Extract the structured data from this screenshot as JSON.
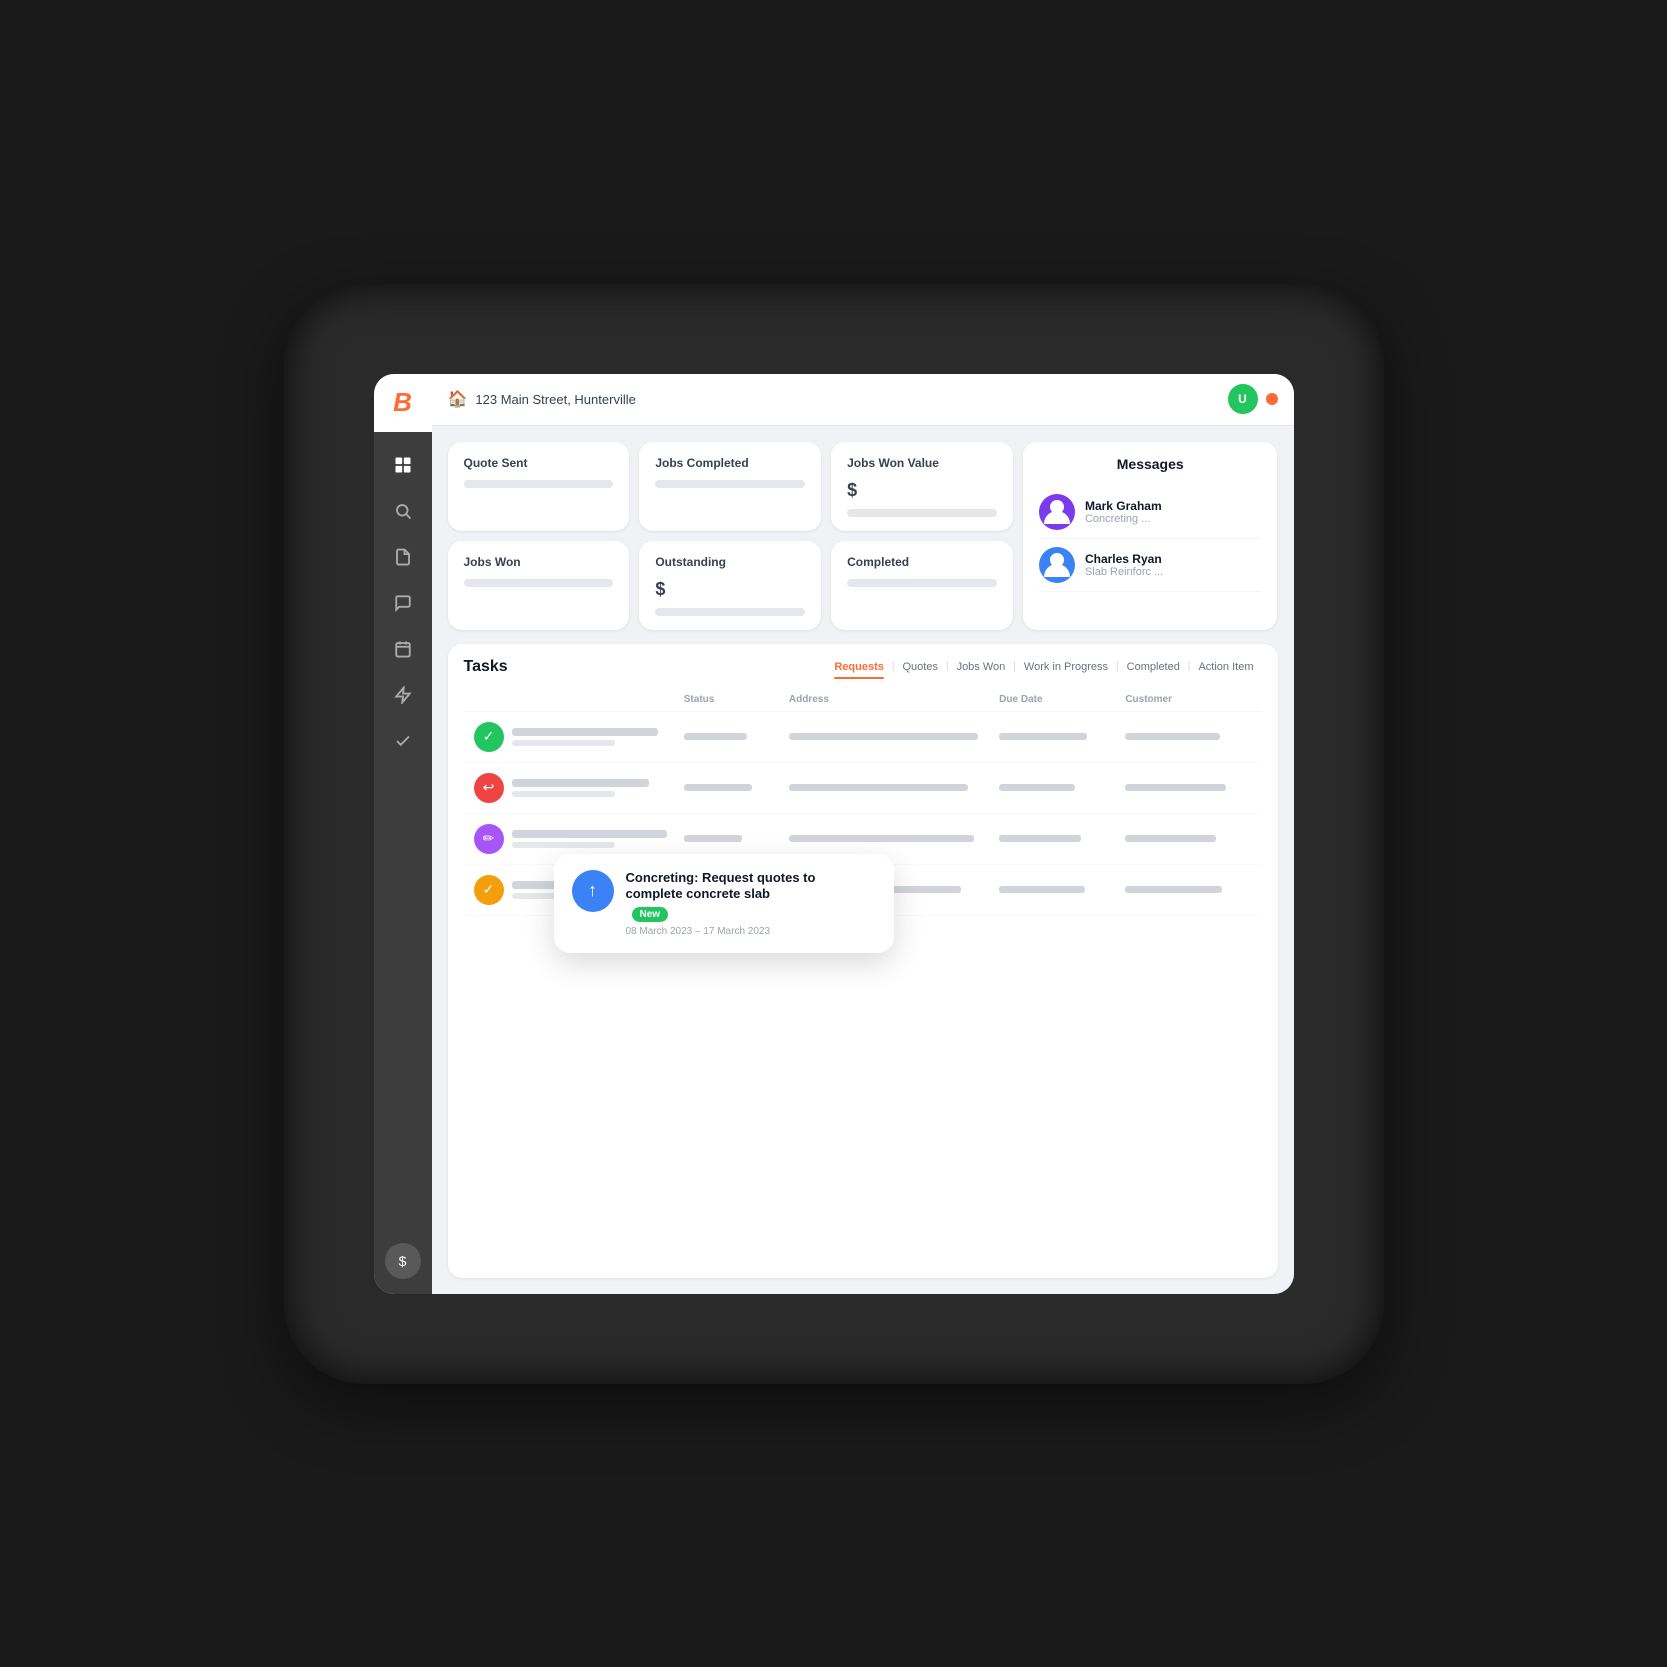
{
  "device": {
    "topbar": {
      "address": "123 Main Street, Hunterville",
      "home_icon": "🏠"
    }
  },
  "sidebar": {
    "items": [
      {
        "icon": "⊞",
        "label": "dashboard",
        "active": true
      },
      {
        "icon": "🔍",
        "label": "search"
      },
      {
        "icon": "📄",
        "label": "documents"
      },
      {
        "icon": "💬",
        "label": "messages"
      },
      {
        "icon": "📅",
        "label": "calendar"
      },
      {
        "icon": "⚡",
        "label": "tasks"
      },
      {
        "icon": "✅",
        "label": "completed"
      }
    ],
    "bottom": {
      "icon": "$",
      "label": "finance"
    }
  },
  "stats": {
    "cards": [
      {
        "title": "Quote Sent",
        "has_value": false
      },
      {
        "title": "Jobs Completed",
        "has_value": false
      },
      {
        "title": "Jobs Won Value",
        "symbol": "$",
        "has_value": true
      },
      {
        "title": "Jobs Won",
        "has_value": false
      },
      {
        "title": "Outstanding",
        "symbol": "$",
        "has_value": true
      },
      {
        "title": "Completed",
        "has_value": false
      }
    ],
    "messages": {
      "title": "Messages",
      "items": [
        {
          "name": "Mark Graham",
          "preview": "Concreting ...",
          "avatar_color": "purple"
        },
        {
          "name": "Charles Ryan",
          "preview": "Slab Reinforc ...",
          "avatar_color": "blue"
        }
      ]
    }
  },
  "tasks": {
    "title": "Tasks",
    "tabs": [
      {
        "label": "Requests",
        "active": true
      },
      {
        "label": "Quotes"
      },
      {
        "label": "Jobs Won"
      },
      {
        "label": "Work in Progress"
      },
      {
        "label": "Completed"
      },
      {
        "label": "Action Item"
      }
    ],
    "table_headers": [
      "",
      "Status",
      "Address",
      "Due Date",
      "Customer"
    ],
    "rows": [
      {
        "icon_color": "#22c55e",
        "icon": "✓"
      },
      {
        "icon_color": "#ef4444",
        "icon": "↩"
      },
      {
        "icon_color": "#a855f7",
        "icon": "✏"
      },
      {
        "icon_color": "#f59e0b",
        "icon": "✓✓"
      }
    ]
  },
  "popup": {
    "title": "Concreting: Request quotes to complete concrete slab",
    "badge": "New",
    "date_range": "08 March 2023 – 17 March 2023",
    "icon": "↑"
  }
}
